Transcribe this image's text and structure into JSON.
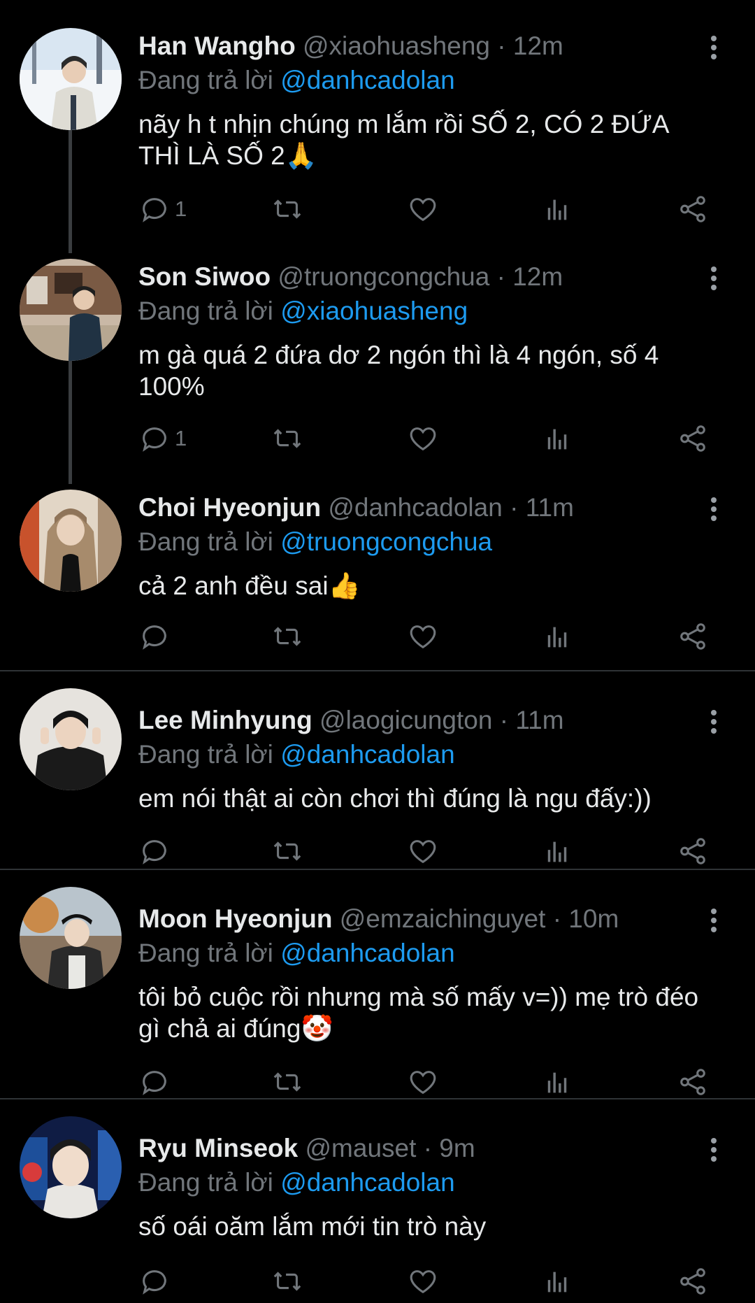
{
  "tweets": [
    {
      "name": "Han Wangho",
      "handle": "@xiaohuasheng",
      "time": "12m",
      "reply_prefix": "Đang trả lời",
      "reply_to": "@danhcadolan",
      "text": "nãy h t nhịn chúng m lắm rồi SỐ 2, CÓ 2 ĐỨA THÌ LÀ SỐ 2🙏",
      "reply_count": "1",
      "avatar_colors": [
        "#cfe0ef",
        "#f4f7fa"
      ]
    },
    {
      "name": "Son Siwoo",
      "handle": "@truongcongchua",
      "time": "12m",
      "reply_prefix": "Đang trả lời",
      "reply_to": "@xiaohuasheng",
      "text": "m gà quá 2 đứa dơ 2 ngón thì là 4 ngón, số 4 100%",
      "reply_count": "1",
      "avatar_colors": [
        "#9c7a60",
        "#2a3a4a"
      ]
    },
    {
      "name": "Choi Hyeonjun",
      "handle": "@danhcadolan",
      "time": "11m",
      "reply_prefix": "Đang trả lời",
      "reply_to": "@truongcongchua",
      "text": "cả 2 anh đều sai👍",
      "reply_count": "",
      "avatar_colors": [
        "#8b6b4e",
        "#b9a48c"
      ]
    },
    {
      "name": "Lee Minhyung",
      "handle": "@laogicungton",
      "time": "11m",
      "reply_prefix": "Đang trả lời",
      "reply_to": "@danhcadolan",
      "text": "em nói thật ai còn chơi thì đúng là ngu đấy:))",
      "reply_count": "",
      "avatar_colors": [
        "#d8d5d0",
        "#1a1a1a"
      ]
    },
    {
      "name": "Moon Hyeonjun",
      "handle": "@emzaichinguyet",
      "time": "10m",
      "reply_prefix": "Đang trả lời",
      "reply_to": "@danhcadolan",
      "text": "tôi bỏ cuộc rồi nhưng mà số mấy v=)) mẹ trò đéo gì chả ai đúng🤡",
      "reply_count": "",
      "avatar_colors": [
        "#c9a27a",
        "#2c2c2c"
      ]
    },
    {
      "name": "Ryu Minseok",
      "handle": "@mauset",
      "time": "9m",
      "reply_prefix": "Đang trả lời",
      "reply_to": "@danhcadolan",
      "text": "số oái oăm lắm mới tin trò này",
      "reply_count": "",
      "avatar_colors": [
        "#1f3a7a",
        "#e9d6c8"
      ]
    }
  ],
  "icons": [
    "reply-icon",
    "retweet-icon",
    "like-icon",
    "views-icon",
    "share-icon",
    "more-icon"
  ],
  "colors": {
    "background": "#000000",
    "text": "#e7e9ea",
    "muted": "#71767b",
    "accent": "#1d9bf0",
    "divider": "#2f3336"
  }
}
